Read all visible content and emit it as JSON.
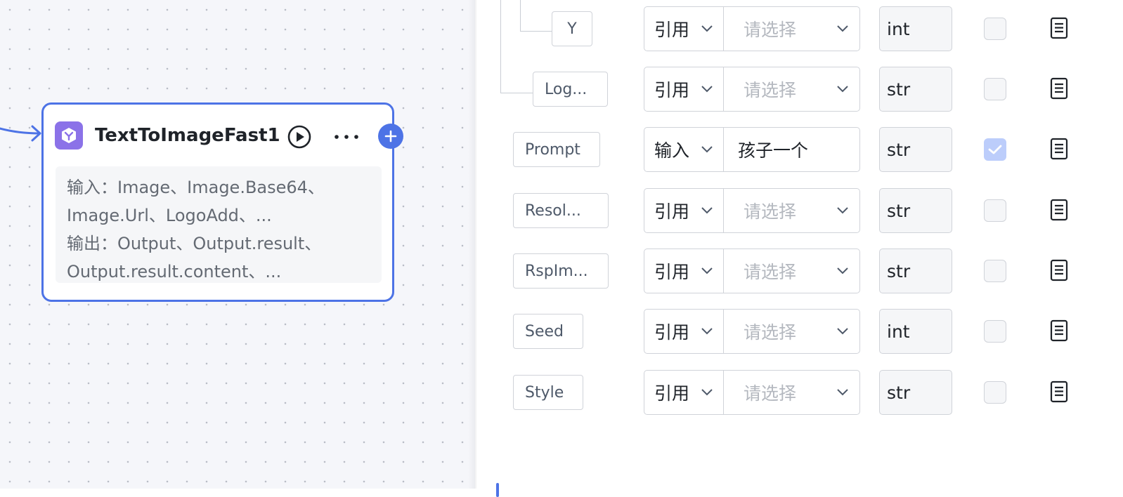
{
  "node": {
    "title": "TextToImageFast1",
    "summary_lines": [
      "输入：Image、Image.Base64、",
      "Image.Url、LogoAdd、...",
      "输出：Output、Output.result、",
      "Output.result.content、..."
    ],
    "colors": {
      "accent": "#4d73e6",
      "icon_bg": "#8b72e8"
    },
    "icons": [
      "cube-icon",
      "play-circle-icon",
      "more-icon",
      "plus-icon"
    ]
  },
  "params": [
    {
      "name": "Y",
      "type": "引用",
      "value": "",
      "placeholder": "请选择",
      "dtype": "int",
      "required": false
    },
    {
      "name": "Log...",
      "type": "引用",
      "value": "",
      "placeholder": "请选择",
      "dtype": "str",
      "required": false
    },
    {
      "name": "Prompt",
      "type": "输入",
      "value": "孩子一个",
      "placeholder": "",
      "dtype": "str",
      "required": true
    },
    {
      "name": "Resol...",
      "type": "引用",
      "value": "",
      "placeholder": "请选择",
      "dtype": "str",
      "required": false
    },
    {
      "name": "RspIm...",
      "type": "引用",
      "value": "",
      "placeholder": "请选择",
      "dtype": "str",
      "required": false
    },
    {
      "name": "Seed",
      "type": "引用",
      "value": "",
      "placeholder": "请选择",
      "dtype": "int",
      "required": false
    },
    {
      "name": "Style",
      "type": "引用",
      "value": "",
      "placeholder": "请选择",
      "dtype": "str",
      "required": false
    }
  ]
}
